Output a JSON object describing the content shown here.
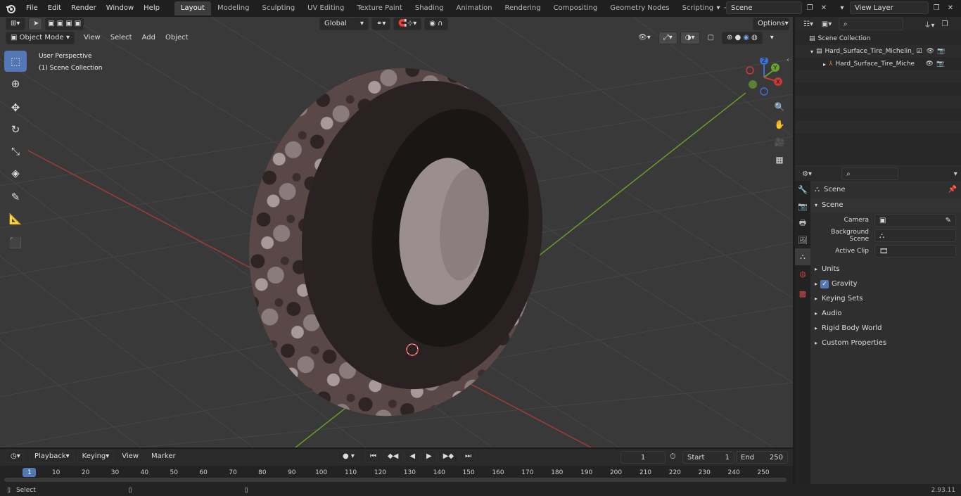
{
  "app": {
    "version": "2.93.11"
  },
  "menu": {
    "items": [
      "File",
      "Edit",
      "Render",
      "Window",
      "Help"
    ]
  },
  "workspaces": {
    "tabs": [
      "Layout",
      "Modeling",
      "Sculpting",
      "UV Editing",
      "Texture Paint",
      "Shading",
      "Animation",
      "Rendering",
      "Compositing",
      "Geometry Nodes",
      "Scripting"
    ],
    "active": "Layout",
    "add": "+"
  },
  "scene_selector": {
    "value": "Scene"
  },
  "view_layer": {
    "value": "View Layer"
  },
  "viewport": {
    "mode": "Object Mode",
    "menu": [
      "View",
      "Select",
      "Add",
      "Object"
    ],
    "transform_orientation": "Global",
    "options_label": "Options",
    "overlay_title": "User Perspective",
    "overlay_subtitle": "(1) Scene Collection",
    "gizmo": {
      "z": "Z",
      "y": "Y",
      "x": "X"
    }
  },
  "outliner": {
    "root": "Scene Collection",
    "items": [
      {
        "name": "Hard_Surface_Tire_Michelin_X",
        "level": 1
      },
      {
        "name": "Hard_Surface_Tire_Miche",
        "level": 2
      }
    ]
  },
  "properties": {
    "context": "Scene",
    "section": "Scene",
    "fields": [
      {
        "label": "Camera",
        "value": ""
      },
      {
        "label": "Background Scene",
        "value": ""
      },
      {
        "label": "Active Clip",
        "value": ""
      }
    ],
    "panels": [
      "Units",
      "Gravity",
      "Keying Sets",
      "Audio",
      "Rigid Body World",
      "Custom Properties"
    ],
    "gravity_checked": true
  },
  "timeline": {
    "menus": [
      "Playback",
      "Keying",
      "View",
      "Marker"
    ],
    "current_frame": "1",
    "start_label": "Start",
    "start": "1",
    "end_label": "End",
    "end": "250",
    "ticks": [
      "1",
      "10",
      "20",
      "30",
      "40",
      "50",
      "60",
      "70",
      "80",
      "90",
      "100",
      "110",
      "120",
      "130",
      "140",
      "150",
      "160",
      "170",
      "180",
      "190",
      "200",
      "210",
      "220",
      "230",
      "240",
      "250"
    ]
  },
  "status": {
    "left": "Select"
  },
  "colors": {
    "accent": "#5478b5",
    "active_tab": "#3d3d3d",
    "grid_red": "#a23a3a",
    "grid_green": "#6a9a2a"
  }
}
